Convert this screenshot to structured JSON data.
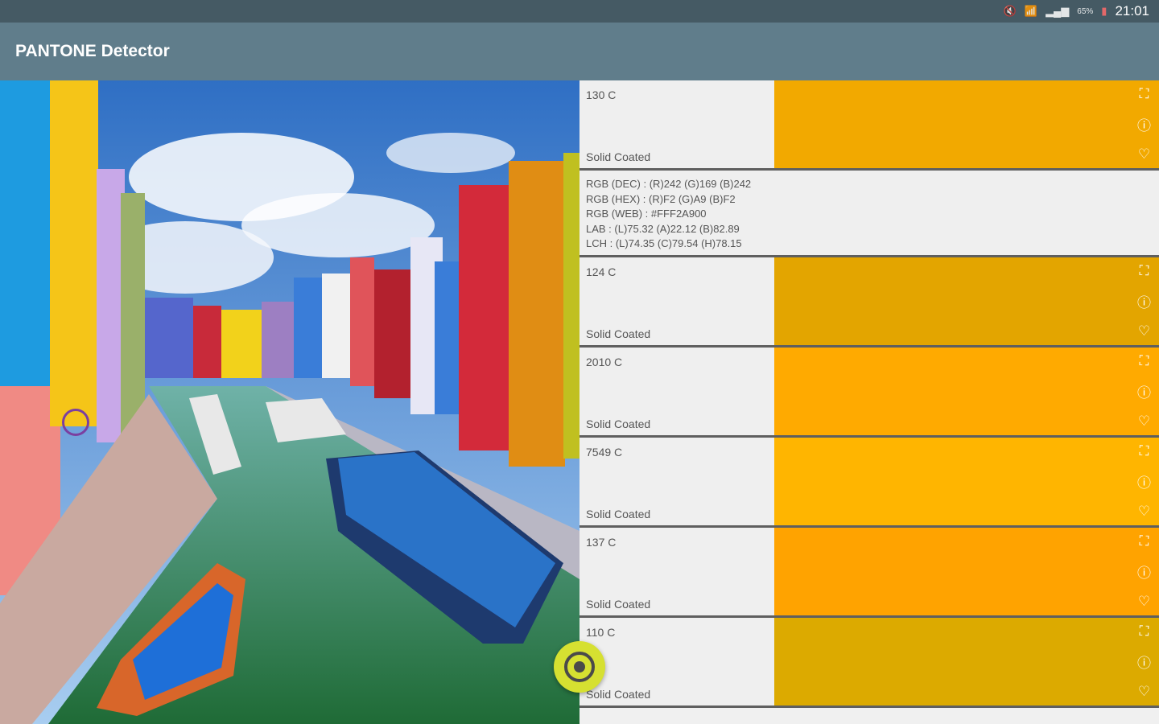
{
  "status": {
    "time": "21:01",
    "battery": "65%",
    "icons": [
      "mute-icon",
      "wifi-icon",
      "signal-icon",
      "battery-icon"
    ]
  },
  "app": {
    "title": "PANTONE Detector"
  },
  "colors": {
    "appbar": "#607d8b",
    "statusbar": "#455a64",
    "fab": "#d6e031"
  },
  "results": [
    {
      "code": "130 C",
      "type": "Solid Coated",
      "hex": "#f2a900"
    },
    {
      "code": "124 C",
      "type": "Solid Coated",
      "hex": "#e3a500"
    },
    {
      "code": "2010 C",
      "type": "Solid Coated",
      "hex": "#ffaa00"
    },
    {
      "code": "7549 C",
      "type": "Solid Coated",
      "hex": "#ffb500"
    },
    {
      "code": "137 C",
      "type": "Solid Coated",
      "hex": "#ffa300"
    },
    {
      "code": "110 C",
      "type": "Solid Coated",
      "hex": "#dcaa00"
    }
  ],
  "details": {
    "rgb_dec": "RGB (DEC) : (R)242  (G)169  (B)242",
    "rgb_hex": "RGB (HEX) : (R)F2  (G)A9  (B)F2",
    "rgb_web": "RGB (WEB) : #FFF2A900",
    "lab": "LAB : (L)75.32  (A)22.12  (B)82.89",
    "lch": "LCH : (L)74.35  (C)79.54  (H)78.15"
  }
}
